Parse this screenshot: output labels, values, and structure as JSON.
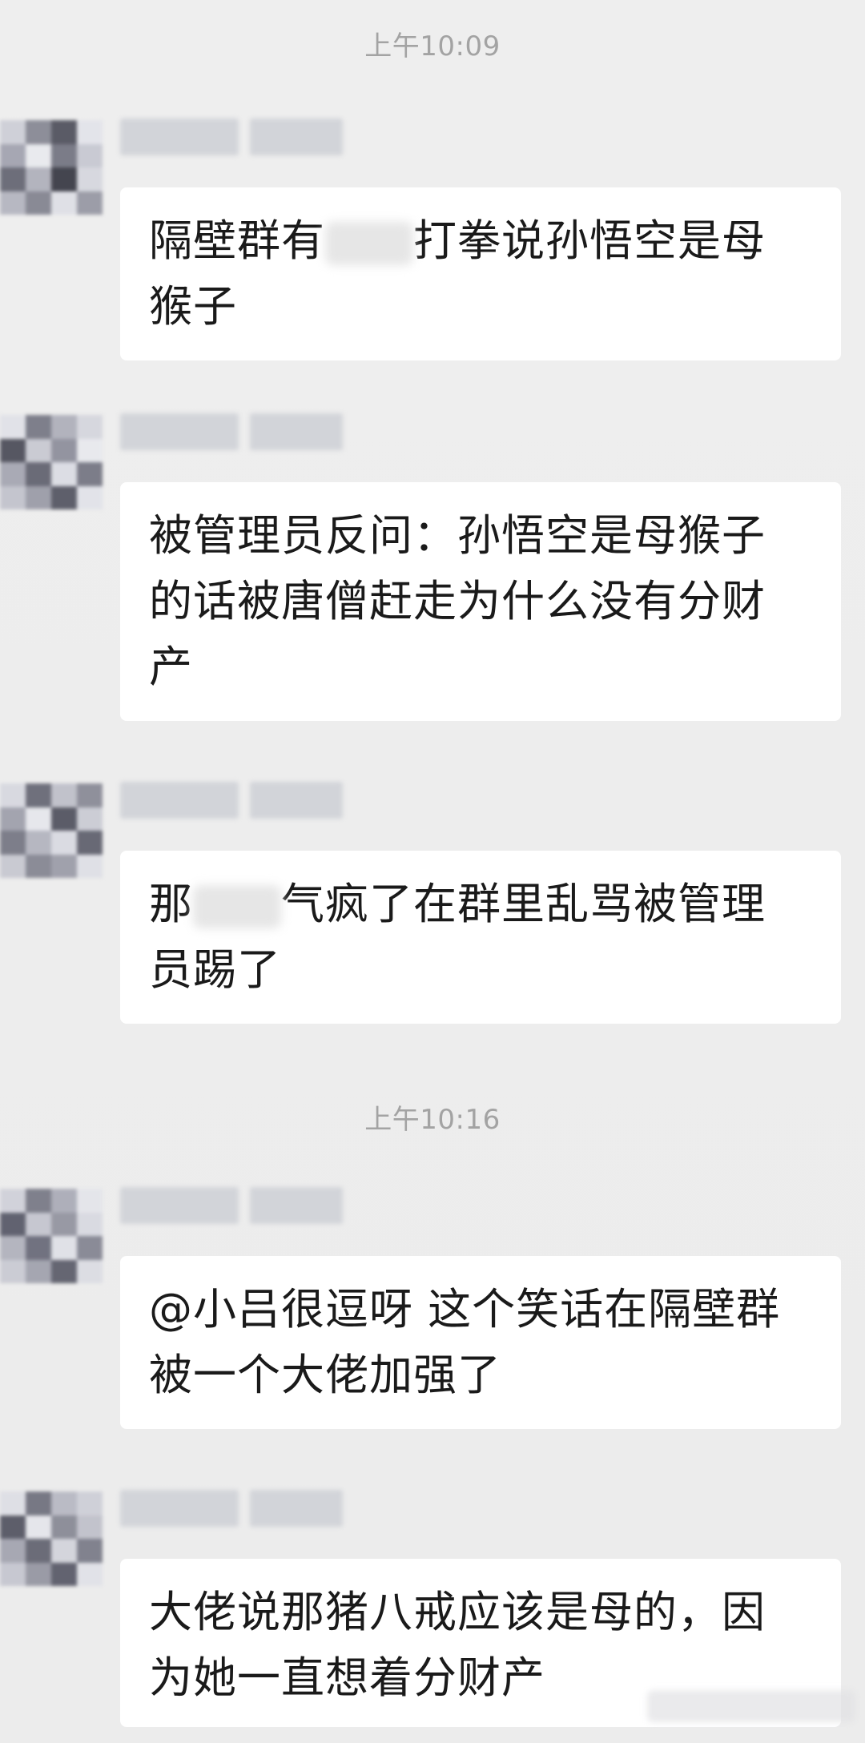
{
  "timestamps": [
    "上午10:09",
    "上午10:16"
  ],
  "messages": [
    {
      "text_before": "隔壁群有",
      "text_after": "打拳说孙悟空是母猴子"
    },
    {
      "text": "被管理员反问：孙悟空是母猴子的话被唐僧赶走为什么没有分财产"
    },
    {
      "text_before": "那",
      "text_after": "气疯了在群里乱骂被管理员踢了"
    },
    {
      "text": "@小吕很逗呀 这个笑话在隔壁群被一个大佬加强了"
    },
    {
      "text": "大佬说那猪八戒应该是母的，因为她一直想着分财产"
    }
  ],
  "colors": {
    "background": "#ededed",
    "bubble": "#ffffff",
    "timestamp": "#a3a3a3",
    "text": "#1a1a1a"
  }
}
